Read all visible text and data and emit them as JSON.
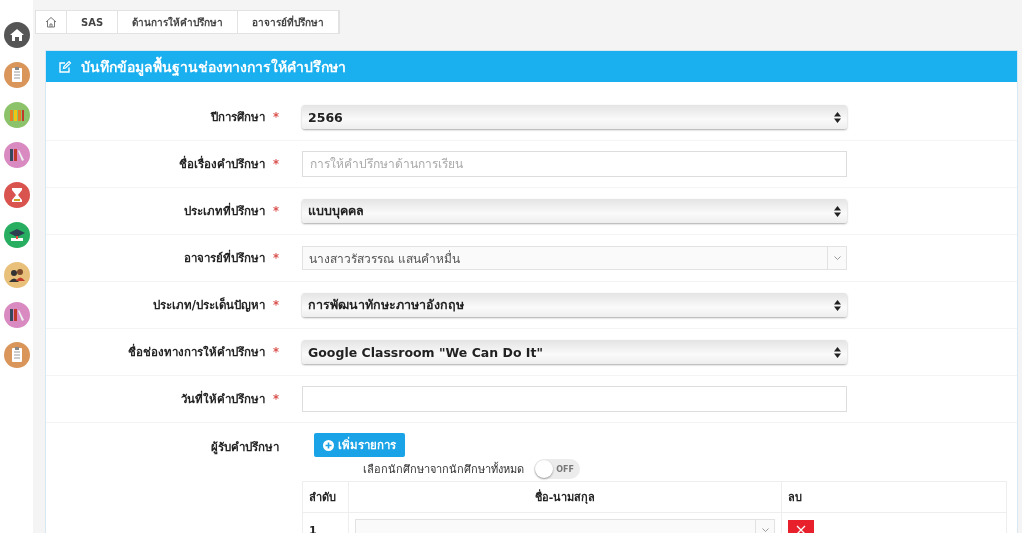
{
  "sidebar": {
    "items": [
      {
        "kind": "home"
      },
      {
        "kind": "clipboard"
      },
      {
        "kind": "files"
      },
      {
        "kind": "binders"
      },
      {
        "kind": "hourglass"
      },
      {
        "kind": "graduation"
      },
      {
        "kind": "people"
      },
      {
        "kind": "binders"
      },
      {
        "kind": "clipboard"
      }
    ]
  },
  "breadcrumb": [
    "SAS",
    "ด้านการให้คำปรึกษา",
    "อาจารย์ที่ปรึกษา"
  ],
  "panel": {
    "title": "บันทึกข้อมูลพื้นฐานช่องทางการให้คำปรึกษา"
  },
  "fields": [
    {
      "kind": "select",
      "label": "ปีการศึกษา",
      "required_mark": "*",
      "value": "2566"
    },
    {
      "kind": "text",
      "label": "ชื่อเรื่องคำปรึกษา",
      "required_mark": "*",
      "placeholder": "การให้คำปรึกษาด้านการเรียน"
    },
    {
      "kind": "select",
      "label": "ประเภทที่ปรึกษา",
      "required_mark": "*",
      "value": "แบบบุคคล"
    },
    {
      "kind": "combo",
      "label": "อาจารย์ที่ปรึกษา",
      "required_mark": "*",
      "value": "นางสาวรัสวรรณ แสนคำหมื่น"
    },
    {
      "kind": "select",
      "label": "ประเภท/ประเด็นปัญหา",
      "required_mark": "*",
      "value": "การพัฒนาทักษะภาษาอังกฤษ"
    },
    {
      "kind": "select",
      "label": "ชื่อช่องทางการให้คำปรึกษา",
      "required_mark": "*",
      "value": "Google Classroom \"We Can Do It\""
    },
    {
      "kind": "text",
      "label": "วันที่ให้คำปรึกษา",
      "required_mark": "*"
    }
  ],
  "recipients": {
    "label": "ผู้รับคำปรึกษา",
    "add_button": "เพิ่มรายการ",
    "toggle": {
      "label": "เลือกนักศึกษาจากนักศึกษาทั้งหมด",
      "on": false,
      "state_text": "OFF"
    },
    "table": {
      "columns": [
        "ลำดับ",
        "ชื่อ-นามสกุล",
        "ลบ"
      ],
      "rows": [
        {
          "number": "1"
        }
      ]
    }
  }
}
